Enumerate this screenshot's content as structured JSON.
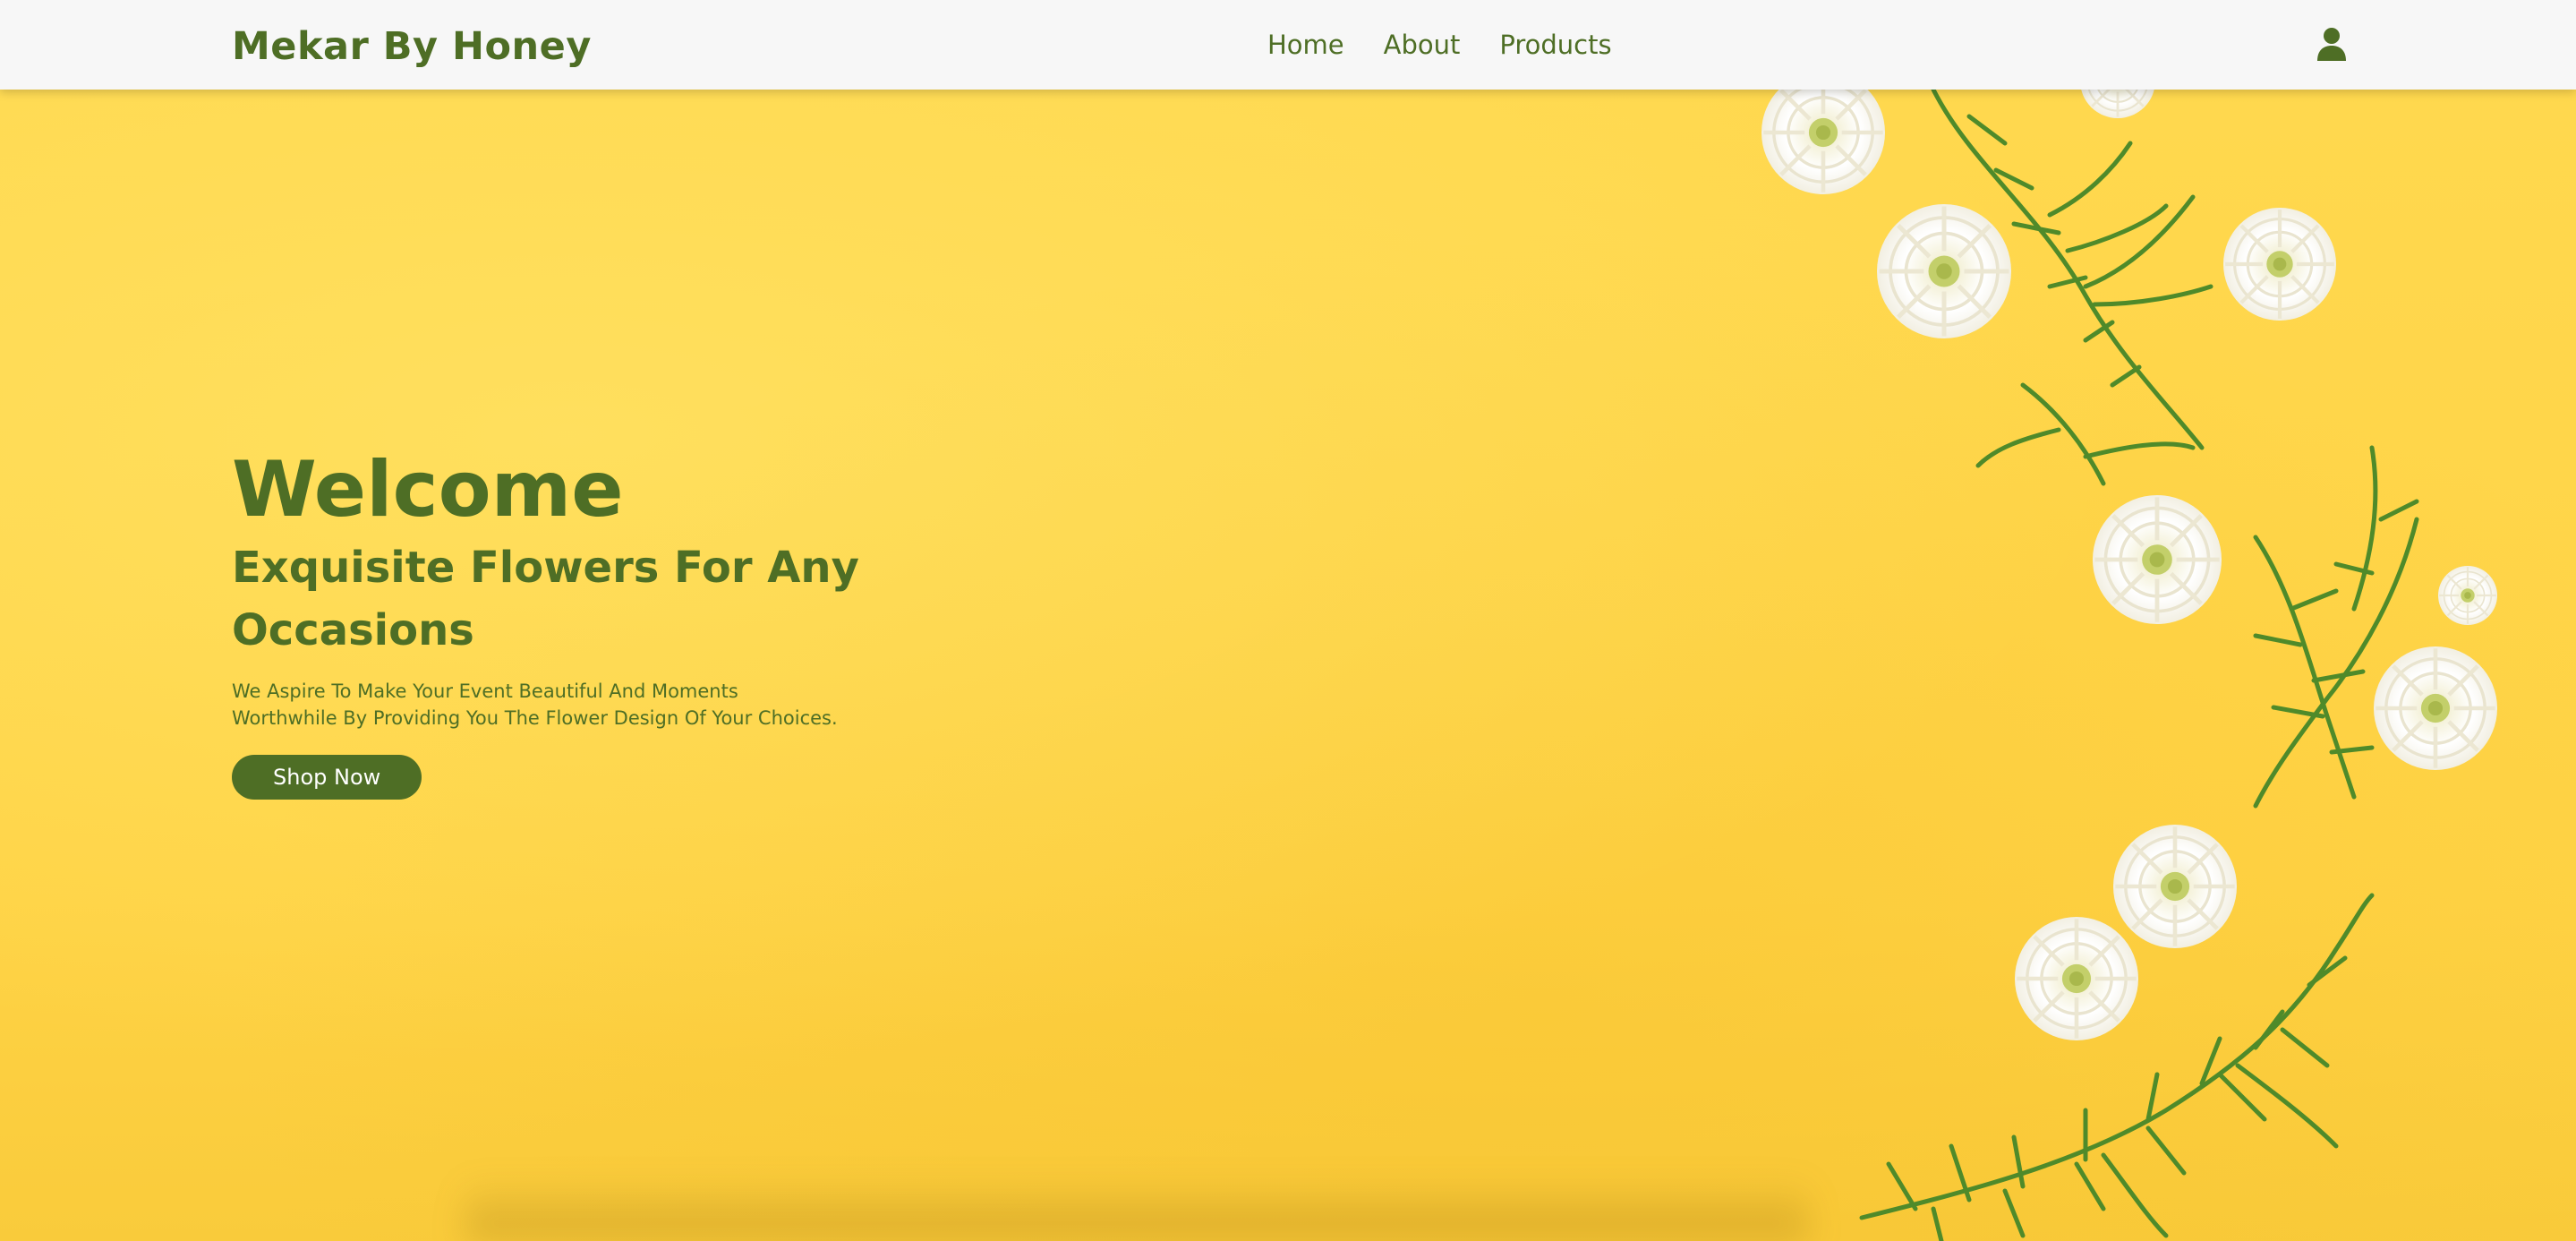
{
  "navbar": {
    "brand": "Mekar By Honey",
    "links": [
      {
        "label": "Home"
      },
      {
        "label": "About"
      },
      {
        "label": "Products"
      }
    ],
    "user_icon": "user-icon"
  },
  "hero": {
    "welcome": "Welcome",
    "tagline": "Exquisite Flowers For Any Occasions",
    "description": "We Aspire To Make Your Event Beautiful And Moments Worthwhile By Providing You The Flower Design Of Your Choices.",
    "cta_label": "Shop Now",
    "background_image": "yellow background with white chrysanthemum flowers and green sprigs"
  },
  "colors": {
    "brand_green": "#4e6e25",
    "hero_yellow": "#ffd54a",
    "navbar_bg": "#f7f7f7"
  }
}
